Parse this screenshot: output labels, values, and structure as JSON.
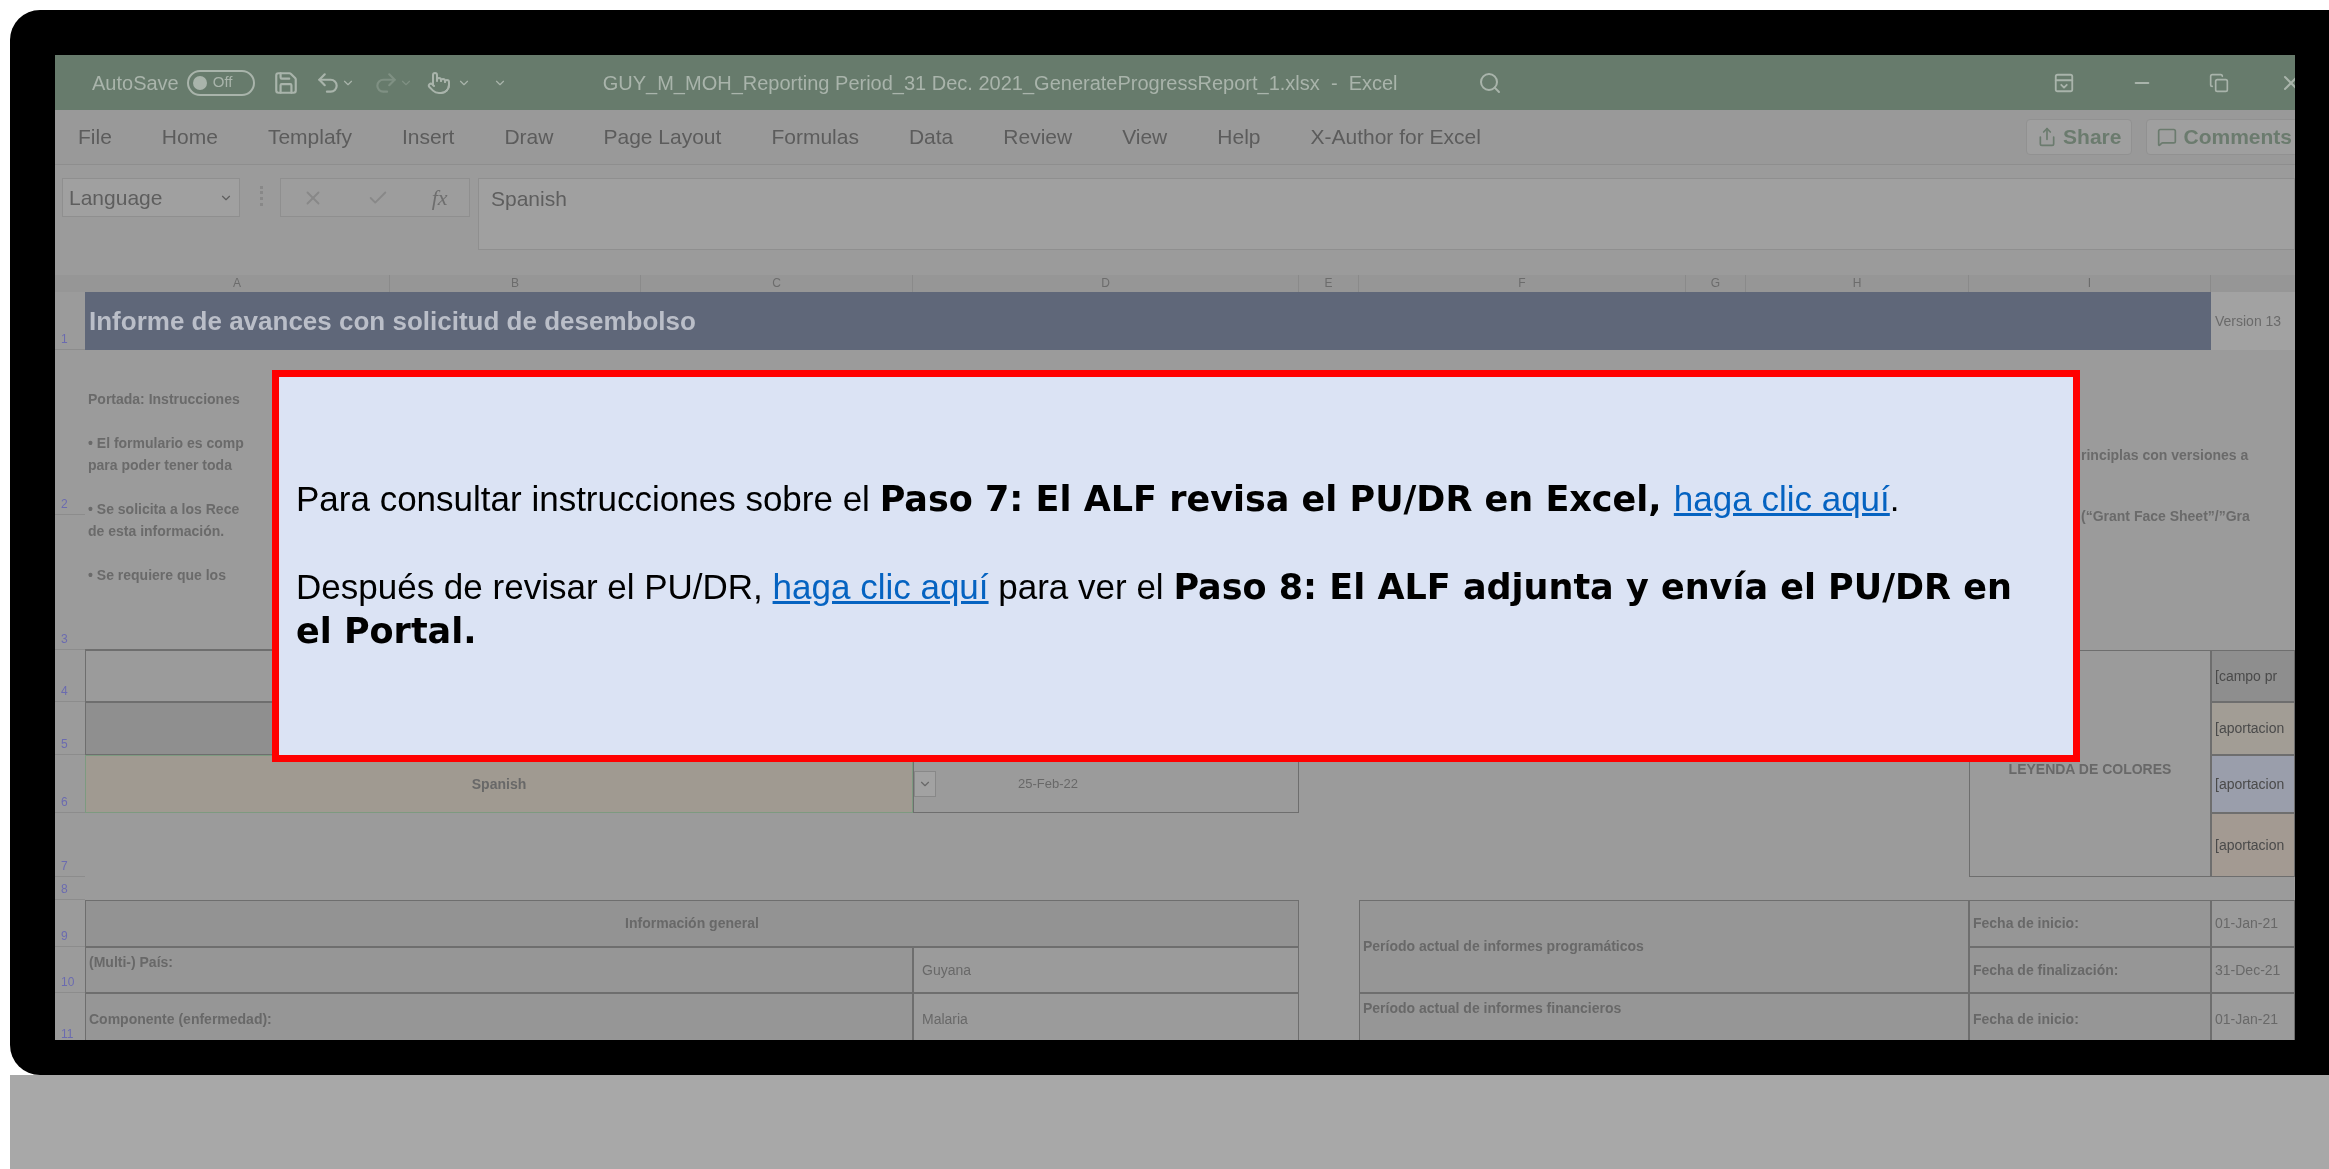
{
  "titlebar": {
    "autosave_label": "AutoSave",
    "autosave_on": false,
    "autosave_state": "Off",
    "title": "GUY_M_MOH_Reporting Period_31 Dec. 2021_GenerateProgressReport_1.xlsx  -  Excel"
  },
  "ribbon_tabs": [
    {
      "label": "File",
      "selected": false
    },
    {
      "label": "Home",
      "selected": false
    },
    {
      "label": "Templafy",
      "selected": false
    },
    {
      "label": "Insert",
      "selected": false
    },
    {
      "label": "Draw",
      "selected": false
    },
    {
      "label": "Page Layout",
      "selected": false
    },
    {
      "label": "Formulas",
      "selected": false
    },
    {
      "label": "Data",
      "selected": false
    },
    {
      "label": "Review",
      "selected": false
    },
    {
      "label": "View",
      "selected": false
    },
    {
      "label": "Help",
      "selected": false
    },
    {
      "label": "X-Author for Excel",
      "selected": false
    }
  ],
  "ribbon_buttons": [
    {
      "kind": "share",
      "label": "Share"
    },
    {
      "kind": "comments",
      "label": "Comments"
    }
  ],
  "formula_bar": {
    "name_box": "Language",
    "fx": "fx",
    "value": "Spanish"
  },
  "columns": [
    "A",
    "B",
    "C",
    "D",
    "E",
    "F",
    "G",
    "H",
    "I"
  ],
  "rows": [
    "1",
    "2",
    "3",
    "4",
    "5",
    "6",
    "7",
    "8",
    "9",
    "10",
    "11"
  ],
  "sheet": {
    "title": "Informe de avances con solicitud de desembolso",
    "version": "Version 13",
    "instructions_left": [
      "Portada: Instrucciones",
      "• El formulario es comp\npara poder tener toda",
      "• Se solicita a los Rece\nde esta información.",
      "• Se requiere que los"
    ],
    "instructions_right": [
      "rinciplas con versiones a",
      "(“Grant Face Sheet”/”Gra"
    ],
    "language_value": "Spanish",
    "date": "25-Feb-22",
    "legend_title": "LEYENDA DE COLORES",
    "legend_items": [
      {
        "text": "[campo pr",
        "color": "#8e8e8e"
      },
      {
        "text": "[aportacion",
        "color": "#a29d95"
      },
      {
        "text": "[aportacion",
        "color": "#9a9eab"
      },
      {
        "text": "[aportacion",
        "color": "#a39a92"
      }
    ],
    "general_header": "Información general",
    "general_rows": [
      {
        "label": "(Multi-) País:",
        "value": "Guyana"
      },
      {
        "label": "Componente (enfermedad):",
        "value": "Malaria"
      }
    ],
    "periods": [
      {
        "label": "Período actual de informes programáticos",
        "dates": [
          {
            "label": "Fecha de inicio:",
            "value": "01-Jan-21"
          },
          {
            "label": "Fecha de finalización:",
            "value": "31-Dec-21"
          }
        ]
      },
      {
        "label": "Período actual de informes financieros",
        "dates": [
          {
            "label": "Fecha de inicio:",
            "value": "01-Jan-21"
          }
        ]
      }
    ]
  },
  "popup": {
    "paragraphs": [
      [
        {
          "kind": "plain",
          "text": "Para consultar instrucciones sobre el "
        },
        {
          "kind": "bold",
          "text": "Paso 7: El ALF revisa el PU/DR en Excel, "
        },
        {
          "kind": "link",
          "text": "haga clic aquí"
        },
        {
          "kind": "plain",
          "text": "."
        }
      ],
      [
        {
          "kind": "plain",
          "text": "Después de revisar el PU/DR, "
        },
        {
          "kind": "link",
          "text": "haga clic aquí"
        },
        {
          "kind": "plain",
          "text": " para ver el "
        },
        {
          "kind": "bold",
          "text": "Paso 8: El ALF adjunta y envía el PU/DR en el Portal."
        }
      ]
    ]
  }
}
